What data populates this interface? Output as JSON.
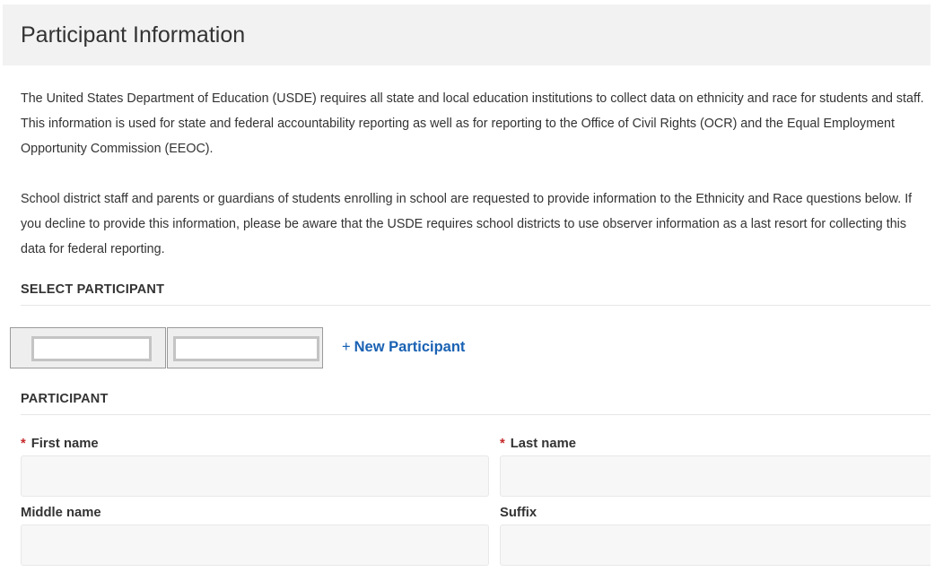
{
  "header": {
    "title": "Participant Information"
  },
  "intro": {
    "paragraph1_lines": [
      "The United States Department of Education (USDE) requires all state and local education institutions to collect data on ethnicity and race for students and staff.",
      "This information is used for state and federal accountability reporting as well as for reporting to the Office of Civil Rights (OCR) and the Equal Employment",
      "Opportunity Commission (EEOC)."
    ],
    "paragraph2_lines": [
      "School district staff and parents or guardians of students enrolling in school are requested to provide information to the Ethnicity and Race questions below. If",
      "you decline to provide this information, please be aware that the USDE requires school districts to use observer information as a last resort for collecting this",
      "data for federal reporting."
    ]
  },
  "select_participant": {
    "title": "SELECT PARTICIPANT",
    "new_participant_plus": "+",
    "new_participant_label": "New Participant"
  },
  "participant": {
    "title": "PARTICIPANT",
    "required_marker": "*",
    "first_name_label": "First name",
    "first_name_value": "",
    "last_name_label": "Last name",
    "last_name_value": "",
    "middle_name_label": "Middle name",
    "middle_name_value": "",
    "suffix_label": "Suffix",
    "suffix_value": ""
  },
  "colors": {
    "link": "#1a62b3",
    "required": "#c62828",
    "header_bg": "#f2f2f2",
    "input_bg": "#f7f7f7"
  }
}
